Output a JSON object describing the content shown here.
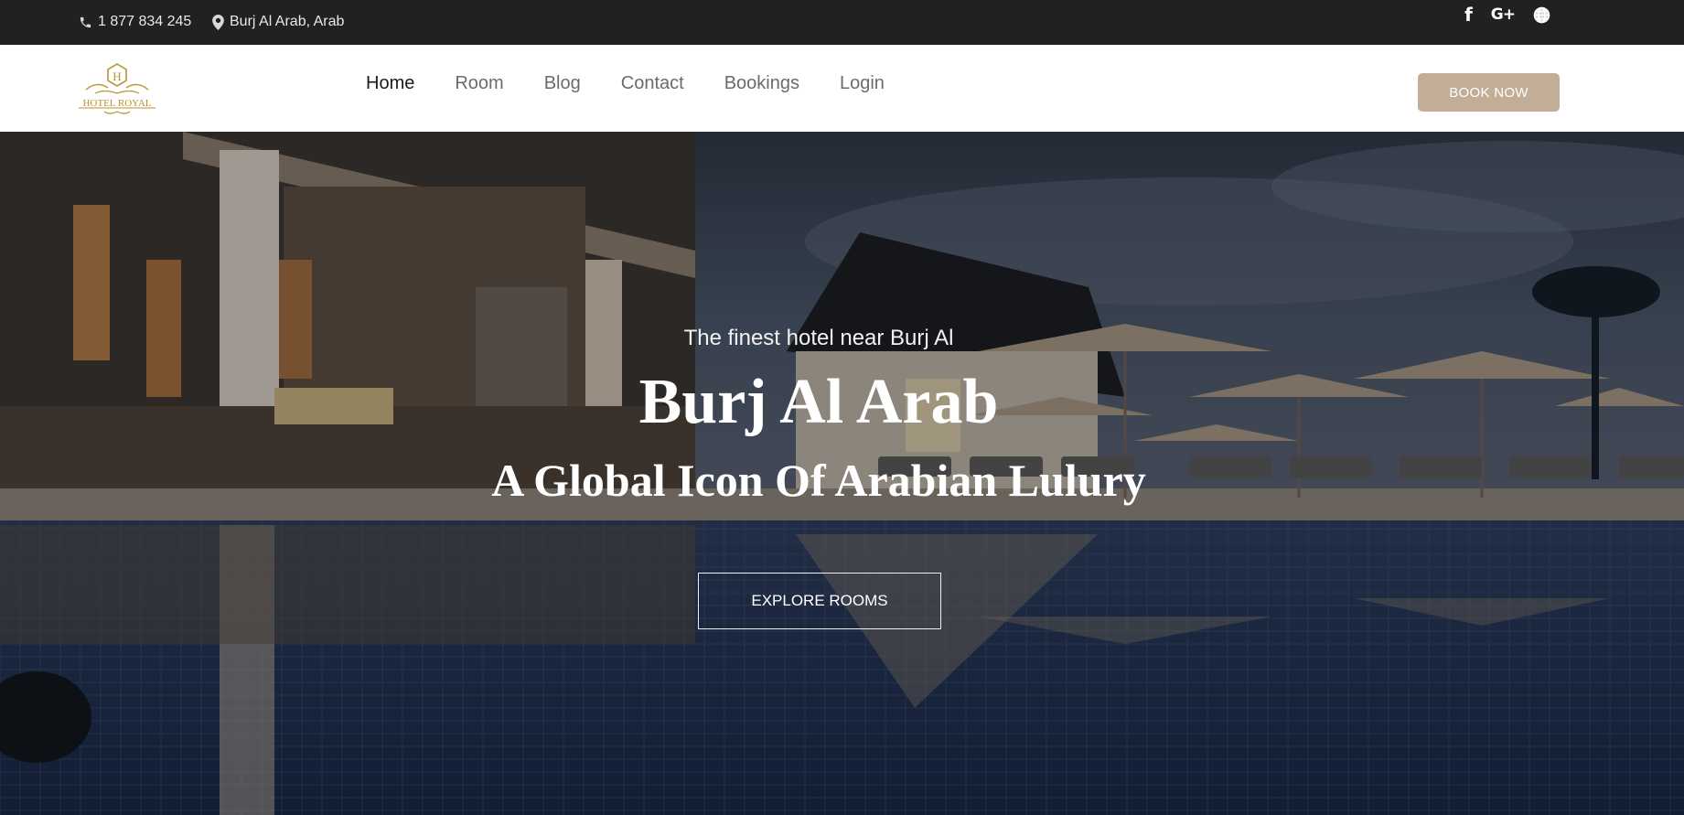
{
  "topbar": {
    "phone": "1 877 834 245",
    "address": "Burj Al Arab, Arab",
    "social": [
      "facebook-icon",
      "google-plus-icon",
      "globe-icon"
    ]
  },
  "header": {
    "logo_letter": "H",
    "logo_text": "HOTEL ROYAL",
    "nav": [
      "Home",
      "Room",
      "Blog",
      "Contact",
      "Bookings",
      "Login"
    ],
    "active_nav": "Home",
    "book_now": "BOOK NOW",
    "accent_color": "#c2ae97"
  },
  "hero": {
    "tagline": "The finest hotel near Burj Al",
    "title": "Burj Al Arab",
    "subtitle": "A Global Icon Of Arabian Lulury",
    "cta": "EXPLORE ROOMS"
  }
}
